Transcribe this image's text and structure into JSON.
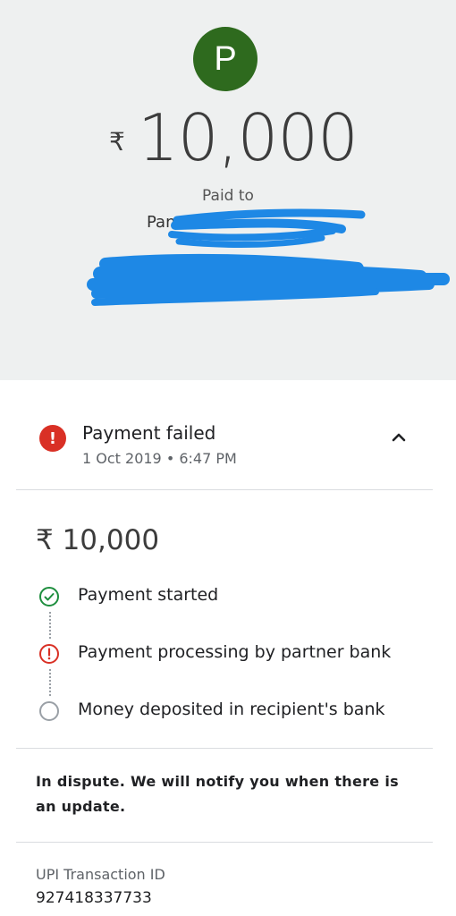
{
  "header": {
    "avatar_letter": "P",
    "currency_symbol": "₹",
    "amount": "10,000",
    "paid_to_label": "Paid to",
    "payee_name": "Pan"
  },
  "status": {
    "title": "Payment failed",
    "timestamp": "1 Oct 2019 • 6:47 PM",
    "icon": "error-icon",
    "collapse_icon": "chevron-up-icon"
  },
  "details": {
    "amount": "₹ 10,000",
    "steps": [
      {
        "label": "Payment started",
        "state": "done",
        "icon": "check-circle-icon"
      },
      {
        "label": "Payment processing by partner bank",
        "state": "error",
        "icon": "error-circle-icon"
      },
      {
        "label": "Money deposited in recipient's bank",
        "state": "pending",
        "icon": "empty-circle-icon"
      }
    ]
  },
  "dispute_note": "In dispute. We will notify you when there is an update.",
  "transaction": {
    "label": "UPI Transaction ID",
    "id": "927418337733"
  },
  "colors": {
    "avatar": "#2e6a1e",
    "error": "#d93025",
    "success": "#1e8e3e",
    "redaction": "#1e88e5",
    "header_bg": "#eef0f0"
  }
}
